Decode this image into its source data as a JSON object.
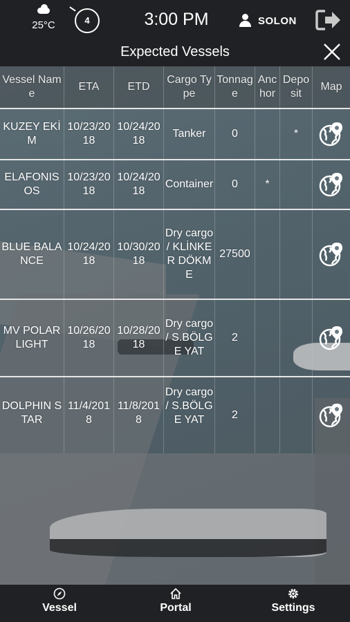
{
  "status": {
    "weather_icon": "cloud-icon",
    "temperature": "25°C",
    "wind_value": "4",
    "time": "3:00 PM",
    "user_name": "SOLON",
    "logout_icon": "logout-icon"
  },
  "header": {
    "title": "Expected Vessels",
    "close_icon": "close-icon"
  },
  "table": {
    "columns": [
      "Vessel Name",
      "ETA",
      "ETD",
      "Cargo Type",
      "Tonnage",
      "Anchor",
      "Deposit",
      "Map"
    ],
    "rows": [
      {
        "vessel": "KUZEY EKİM",
        "eta": "10/23/2018",
        "etd": "10/24/2018",
        "cargo": "Tanker",
        "tonnage": "0",
        "anchor": "",
        "deposit": "*",
        "map_icon": "map-pin-globe-icon"
      },
      {
        "vessel": "ELAFONISOS",
        "eta": "10/23/2018",
        "etd": "10/24/2018",
        "cargo": "Container",
        "tonnage": "0",
        "anchor": "*",
        "deposit": "",
        "map_icon": "map-pin-globe-icon"
      },
      {
        "vessel": "BLUE BALANCE",
        "eta": "10/24/2018",
        "etd": "10/30/2018",
        "cargo": "Dry cargo / KLİNKER DÖKME",
        "tonnage": "27500",
        "anchor": "",
        "deposit": "",
        "map_icon": "map-pin-globe-icon"
      },
      {
        "vessel": "MV POLARLIGHT",
        "eta": "10/26/2018",
        "etd": "10/28/2018",
        "cargo": "Dry cargo / S.BÖLGE YAT",
        "tonnage": "2",
        "anchor": "",
        "deposit": "",
        "map_icon": "map-pin-globe-icon"
      },
      {
        "vessel": "DOLPHIN STAR",
        "eta": "11/4/2018",
        "etd": "11/8/2018",
        "cargo": "Dry cargo / S.BÖLGE YAT",
        "tonnage": "2",
        "anchor": "",
        "deposit": "",
        "map_icon": "map-pin-globe-icon"
      }
    ]
  },
  "nav": {
    "items": [
      {
        "label": "Vessel",
        "icon": "compass-icon"
      },
      {
        "label": "Portal",
        "icon": "home-icon"
      },
      {
        "label": "Settings",
        "icon": "gear-icon"
      }
    ]
  },
  "colors": {
    "bar_background": "#202124",
    "divider": "#e6e6e6",
    "text": "#ffffff"
  }
}
